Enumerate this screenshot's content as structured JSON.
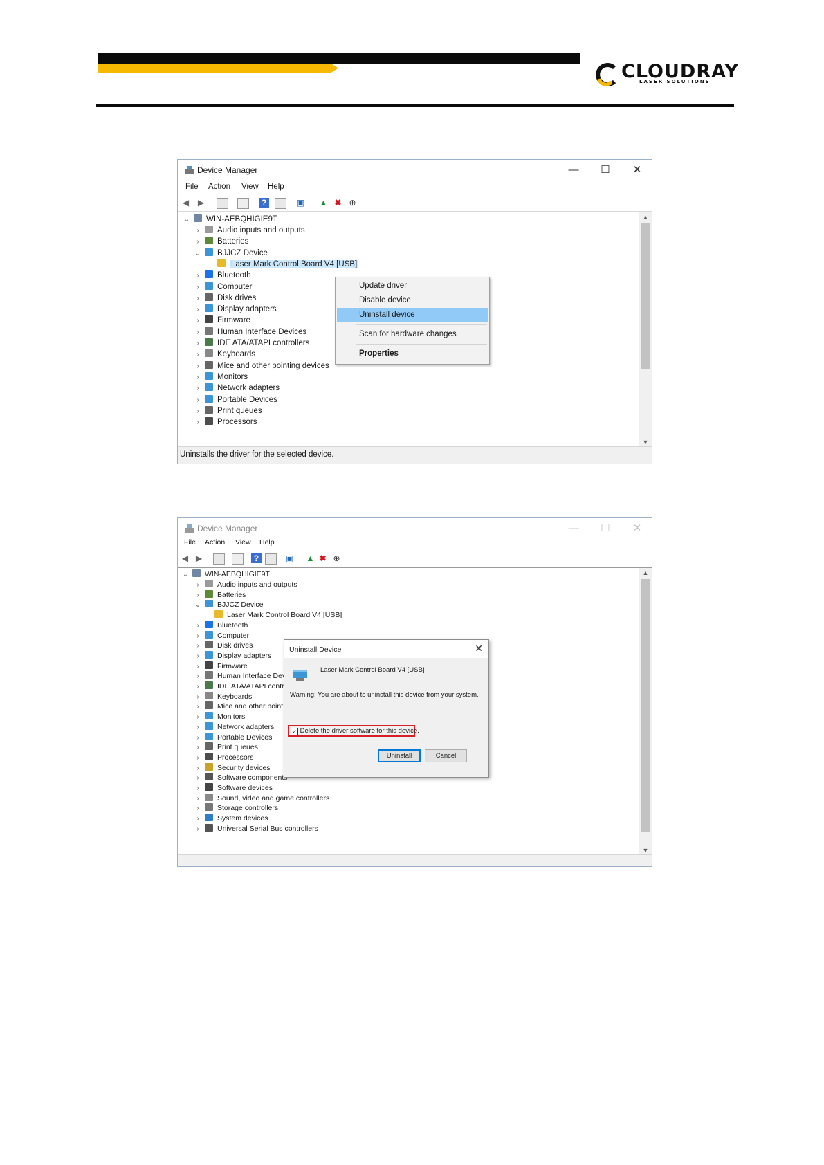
{
  "header": {
    "logo": {
      "brand": "CLOUDRAY",
      "tagline": "LASER SOLUTIONS",
      "colors": {
        "yellow": "#f6b800",
        "black": "#0a0a0a"
      }
    }
  },
  "screenshot1": {
    "title": "Device Manager",
    "menu": [
      "File",
      "Action",
      "View",
      "Help"
    ],
    "computer": "WIN-AEBQHIGIE9T",
    "tree": [
      {
        "label": "Audio inputs and outputs",
        "expand": "›",
        "icon": "speaker-icon"
      },
      {
        "label": "Batteries",
        "expand": "›",
        "icon": "battery-icon"
      },
      {
        "label": "BJJCZ Device",
        "expand": "⌄",
        "icon": "device-icon"
      },
      {
        "label": "Laser Mark Control Board V4 [USB]",
        "expand": "",
        "icon": "warning-device-icon",
        "child": true,
        "selected": true
      },
      {
        "label": "Bluetooth",
        "expand": "›",
        "icon": "bluetooth-icon"
      },
      {
        "label": "Computer",
        "expand": "›",
        "icon": "computer-icon"
      },
      {
        "label": "Disk drives",
        "expand": "›",
        "icon": "disk-icon"
      },
      {
        "label": "Display adapters",
        "expand": "›",
        "icon": "display-icon"
      },
      {
        "label": "Firmware",
        "expand": "›",
        "icon": "chip-icon"
      },
      {
        "label": "Human Interface Devices",
        "expand": "›",
        "icon": "hid-icon"
      },
      {
        "label": "IDE ATA/ATAPI controllers",
        "expand": "›",
        "icon": "ide-icon"
      },
      {
        "label": "Keyboards",
        "expand": "›",
        "icon": "keyboard-icon"
      },
      {
        "label": "Mice and other pointing devices",
        "expand": "›",
        "icon": "mouse-icon"
      },
      {
        "label": "Monitors",
        "expand": "›",
        "icon": "monitor-icon"
      },
      {
        "label": "Network adapters",
        "expand": "›",
        "icon": "network-icon"
      },
      {
        "label": "Portable Devices",
        "expand": "›",
        "icon": "portable-icon"
      },
      {
        "label": "Print queues",
        "expand": "›",
        "icon": "printer-icon"
      },
      {
        "label": "Processors",
        "expand": "›",
        "icon": "processor-icon"
      }
    ],
    "context_menu": {
      "update": "Update driver",
      "disable": "Disable device",
      "uninstall": "Uninstall device",
      "scan": "Scan for hardware changes",
      "properties": "Properties"
    },
    "status": "Uninstalls the driver for the selected device."
  },
  "screenshot2": {
    "title": "Device Manager",
    "menu": [
      "File",
      "Action",
      "View",
      "Help"
    ],
    "computer": "WIN-AEBQHIGIE9T",
    "tree": [
      {
        "label": "Audio inputs and outputs",
        "expand": "›",
        "icon": "speaker-icon"
      },
      {
        "label": "Batteries",
        "expand": "›",
        "icon": "battery-icon"
      },
      {
        "label": "BJJCZ Device",
        "expand": "⌄",
        "icon": "device-icon"
      },
      {
        "label": "Laser Mark Control Board V4 [USB]",
        "expand": "",
        "icon": "warning-device-icon",
        "child": true
      },
      {
        "label": "Bluetooth",
        "expand": "›",
        "icon": "bluetooth-icon"
      },
      {
        "label": "Computer",
        "expand": "›",
        "icon": "computer-icon"
      },
      {
        "label": "Disk drives",
        "expand": "›",
        "icon": "disk-icon"
      },
      {
        "label": "Display adapters",
        "expand": "›",
        "icon": "display-icon"
      },
      {
        "label": "Firmware",
        "expand": "›",
        "icon": "chip-icon"
      },
      {
        "label": "Human Interface Dev",
        "expand": "›",
        "icon": "hid-icon"
      },
      {
        "label": "IDE ATA/ATAPI control",
        "expand": "›",
        "icon": "ide-icon"
      },
      {
        "label": "Keyboards",
        "expand": "›",
        "icon": "keyboard-icon"
      },
      {
        "label": "Mice and other point",
        "expand": "›",
        "icon": "mouse-icon"
      },
      {
        "label": "Monitors",
        "expand": "›",
        "icon": "monitor-icon"
      },
      {
        "label": "Network adapters",
        "expand": "›",
        "icon": "network-icon"
      },
      {
        "label": "Portable Devices",
        "expand": "›",
        "icon": "portable-icon"
      },
      {
        "label": "Print queues",
        "expand": "›",
        "icon": "printer-icon"
      },
      {
        "label": "Processors",
        "expand": "›",
        "icon": "processor-icon"
      },
      {
        "label": "Security devices",
        "expand": "›",
        "icon": "security-icon"
      },
      {
        "label": "Software components",
        "expand": "›",
        "icon": "software-component-icon"
      },
      {
        "label": "Software devices",
        "expand": "›",
        "icon": "software-device-icon"
      },
      {
        "label": "Sound, video and game controllers",
        "expand": "›",
        "icon": "sound-icon"
      },
      {
        "label": "Storage controllers",
        "expand": "›",
        "icon": "storage-icon"
      },
      {
        "label": "System devices",
        "expand": "›",
        "icon": "system-icon"
      },
      {
        "label": "Universal Serial Bus controllers",
        "expand": "›",
        "icon": "usb-icon"
      }
    ],
    "dialog": {
      "title": "Uninstall Device",
      "device": "Laser Mark Control Board V4 [USB]",
      "warning": "Warning: You are about to uninstall this device from your system.",
      "checkbox": "Delete the driver software for this device.",
      "checkbox_checked": true,
      "uninstall": "Uninstall",
      "cancel": "Cancel",
      "highlight_color": "#d42027"
    }
  }
}
